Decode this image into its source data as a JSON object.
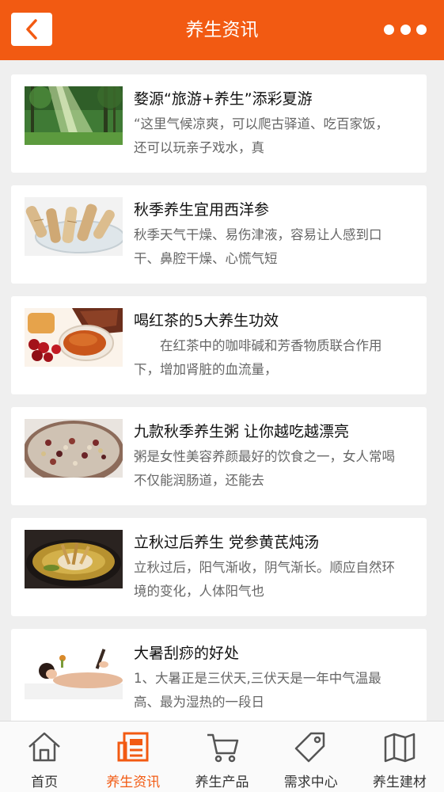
{
  "header": {
    "title": "养生资讯",
    "back_icon": "chevron-left-icon",
    "more_icon": "more-dots-icon"
  },
  "colors": {
    "brand": "#f25a12",
    "tab_active": "#f25a12",
    "tab_inactive": "#555555"
  },
  "articles": [
    {
      "title": "婺源“旅游+养生”添彩夏游",
      "summary": "“这里气候凉爽，可以爬古驿道、吃百家饭，还可以玩亲子戏水，真",
      "image": "forest-sunlight-image"
    },
    {
      "title": "秋季养生宜用西洋参",
      "summary": "秋季天气干燥、易伤津液，容易让人感到口干、鼻腔干燥、心慌气短",
      "image": "ginseng-image"
    },
    {
      "title": "喝红茶的5大养生功效",
      "summary": "　　在红茶中的咖啡碱和芳香物质联合作用下，增加肾脏的血流量，",
      "image": "black-tea-image"
    },
    {
      "title": "九款秋季养生粥 让你越吃越漂亮",
      "summary": "粥是女性美容养颜最好的饮食之一，女人常喝不仅能润肠道，还能去",
      "image": "bean-porridge-image"
    },
    {
      "title": "立秋过后养生 党参黄芪炖汤",
      "summary": "立秋过后，阳气渐收，阴气渐长。顺应自然环境的变化，人体阳气也",
      "image": "herbal-soup-image"
    },
    {
      "title": "大暑刮痧的好处",
      "summary": "1、大暑正是三伏天,三伏天是一年中气温最高、最为湿热的一段日",
      "image": "gua-sha-massage-image"
    }
  ],
  "tabs": [
    {
      "label": "首页",
      "icon": "home-icon",
      "active": false
    },
    {
      "label": "养生资讯",
      "icon": "news-icon",
      "active": true
    },
    {
      "label": "养生产品",
      "icon": "cart-icon",
      "active": false
    },
    {
      "label": "需求中心",
      "icon": "tag-icon",
      "active": false
    },
    {
      "label": "养生建材",
      "icon": "map-icon",
      "active": false
    }
  ]
}
